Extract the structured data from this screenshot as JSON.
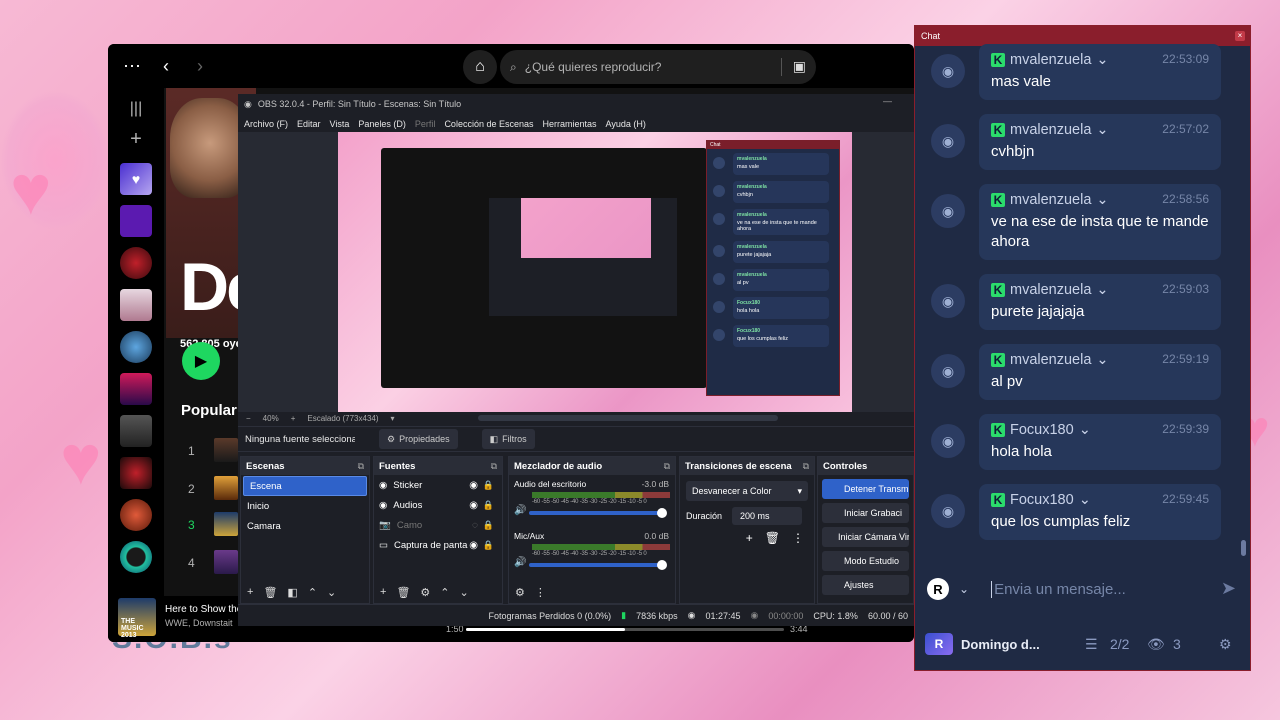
{
  "desktop": {
    "bottom_text": "S.O.B.s"
  },
  "spotify": {
    "search_placeholder": "¿Qué quieres reproducir?",
    "artist_initial": "De",
    "listeners": "562.805 oye",
    "popular_label": "Popular",
    "tracks": [
      "1",
      "2",
      "3",
      "4"
    ],
    "now_playing": {
      "title": "Here to Show the",
      "artist": "WWE, Downstait",
      "art_text": "THE MUSIC 2013",
      "elapsed": "1:50",
      "duration": "3:44",
      "progress": 0.5
    }
  },
  "obs": {
    "title": "OBS 32.0.4 - Perfil: Sin Título - Escenas: Sin Título",
    "menu": [
      "Archivo (F)",
      "Editar",
      "Vista",
      "Paneles (D)",
      "Perfil",
      "Colección de Escenas",
      "Herramientas",
      "Ayuda (H)"
    ],
    "zoom": "40%",
    "scale": "Escalado (773x434)",
    "no_source": "Ninguna fuente seleccionad",
    "properties": "Propiedades",
    "filters": "Filtros",
    "scenes": {
      "title": "Escenas",
      "items": [
        "Escena",
        "Inicio",
        "Camara"
      ]
    },
    "sources": {
      "title": "Fuentes",
      "items": [
        "Sticker",
        "Audios",
        "Camo",
        "Captura de panta"
      ]
    },
    "mixer": {
      "title": "Mezclador de audio",
      "channels": [
        {
          "name": "Audio del escritorio",
          "db": "-3.0 dB"
        },
        {
          "name": "Mic/Aux",
          "db": "0.0 dB"
        }
      ],
      "ticks": "-60 -55 -50 -45 -40 -35 -30 -25 -20 -15 -10 -5 0"
    },
    "transitions": {
      "title": "Transiciones de escena",
      "selected": "Desvanecer a Color",
      "duration_label": "Duración",
      "duration_value": "200 ms"
    },
    "controls": {
      "title": "Controles",
      "buttons": [
        "Detener Transmi",
        "Iniciar Grabaci",
        "Iniciar Cámara Virtu",
        "Modo Estudio",
        "Ajustes"
      ]
    },
    "status": {
      "dropped": "Fotogramas Perdidos 0 (0.0%)",
      "bitrate": "7836 kbps",
      "stream_time": "01:27:45",
      "rec_time": "00:00:00",
      "cpu": "CPU: 1.8%",
      "fps": "60.00 / 60"
    }
  },
  "chat": {
    "title": "Chat",
    "messages": [
      {
        "user": "mvalenzuela",
        "time": "22:53:09",
        "text": "mas vale"
      },
      {
        "user": "mvalenzuela",
        "time": "22:57:02",
        "text": "cvhbjn"
      },
      {
        "user": "mvalenzuela",
        "time": "22:58:56",
        "text": "ve na ese de insta que te mande ahora"
      },
      {
        "user": "mvalenzuela",
        "time": "22:59:03",
        "text": "purete jajajaja"
      },
      {
        "user": "mvalenzuela",
        "time": "22:59:19",
        "text": "al pv"
      },
      {
        "user": "Focux180",
        "time": "22:59:39",
        "text": "hola hola"
      },
      {
        "user": "Focux180",
        "time": "22:59:45",
        "text": "que los cumplas feliz"
      }
    ],
    "input_placeholder": "Envia un mensaje...",
    "footer": {
      "channel": "Domingo d...",
      "streams": "2/2",
      "viewers": "3"
    },
    "user_badge": "R"
  },
  "colors": {
    "spotify_green": "#1ed760",
    "kick_green": "#2bdc6c",
    "obs_accent": "#2f62c9",
    "chat_bg": "#1f2a44"
  }
}
